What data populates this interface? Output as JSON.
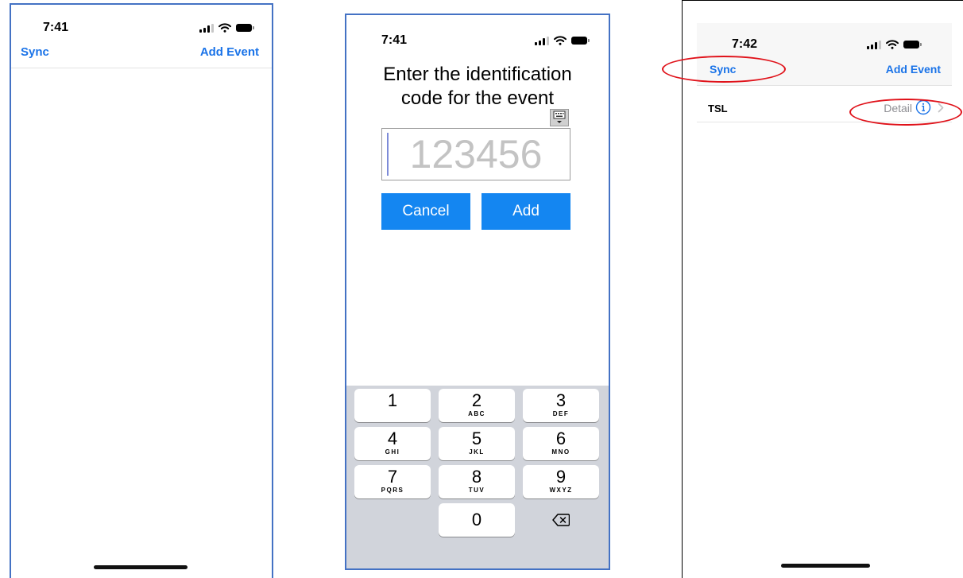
{
  "screen_empty": {
    "status": {
      "time": "7:41"
    },
    "nav": {
      "left_label": "Sync",
      "right_label": "Add Event"
    }
  },
  "screen_code": {
    "status": {
      "time": "7:41"
    },
    "prompt": {
      "line1": "Enter the identification",
      "line2": "code for the event"
    },
    "code_input": {
      "value": "",
      "placeholder": "123456"
    },
    "buttons": {
      "cancel_label": "Cancel",
      "add_label": "Add"
    },
    "keypad": {
      "keys": [
        {
          "digit": "1",
          "letters": ""
        },
        {
          "digit": "2",
          "letters": "ABC"
        },
        {
          "digit": "3",
          "letters": "DEF"
        },
        {
          "digit": "4",
          "letters": "GHI"
        },
        {
          "digit": "5",
          "letters": "JKL"
        },
        {
          "digit": "6",
          "letters": "MNO"
        },
        {
          "digit": "7",
          "letters": "PQRS"
        },
        {
          "digit": "8",
          "letters": "TUV"
        },
        {
          "digit": "9",
          "letters": "WXYZ"
        },
        {
          "digit": "0",
          "letters": ""
        }
      ]
    }
  },
  "screen_list": {
    "status": {
      "time": "7:42"
    },
    "nav": {
      "left_label": "Sync",
      "right_label": "Add Event"
    },
    "events": [
      {
        "title": "TSL",
        "detail_label": "Detail"
      }
    ]
  },
  "colors": {
    "accent": "#1a73e8",
    "button": "#1486f1",
    "highlight": "#e0121a",
    "frame": "#4472c4"
  }
}
